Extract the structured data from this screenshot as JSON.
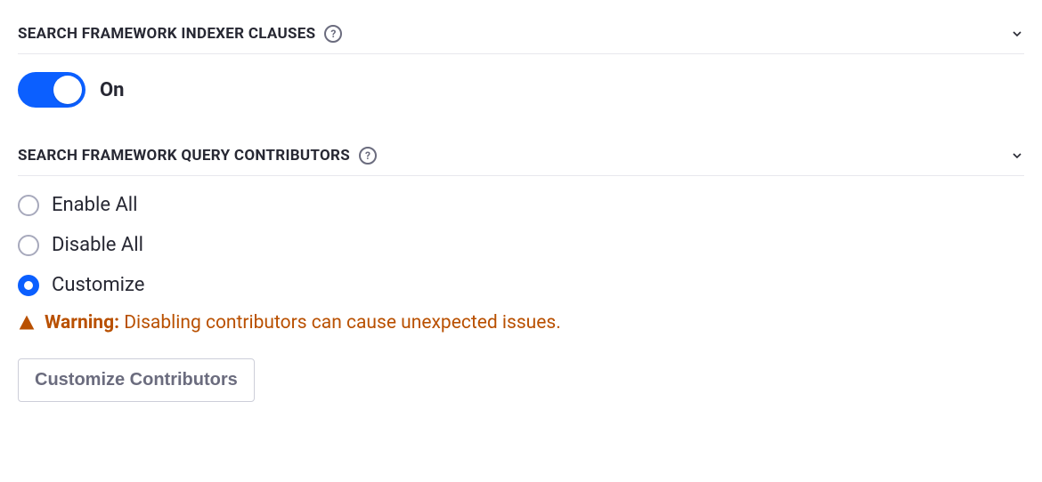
{
  "sections": {
    "indexer": {
      "title": "SEARCH FRAMEWORK INDEXER CLAUSES",
      "toggle_state": "On"
    },
    "query": {
      "title": "SEARCH FRAMEWORK QUERY CONTRIBUTORS",
      "options": {
        "enable_all": "Enable All",
        "disable_all": "Disable All",
        "customize": "Customize"
      },
      "selected": "customize",
      "warning_label": "Warning:",
      "warning_text": "Disabling contributors can cause unexpected issues.",
      "customize_button": "Customize Contributors"
    }
  }
}
